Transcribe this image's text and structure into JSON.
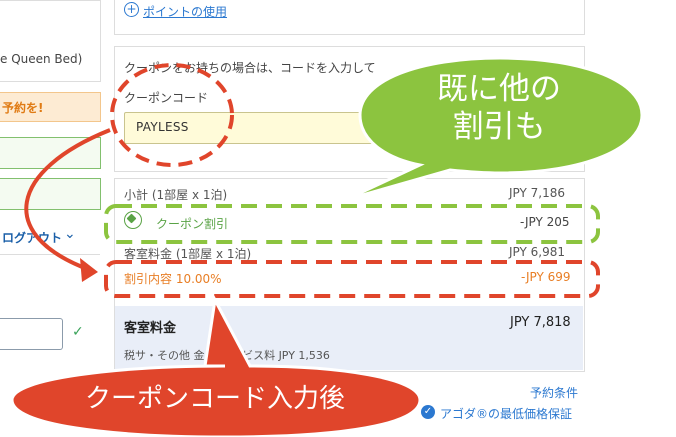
{
  "left_panel": {
    "room_type_fragment": "e Queen Bed)",
    "notice_fragment": "予約を!",
    "logout_fragment": "ログアウト"
  },
  "points": {
    "link_label": "ポイントの使用"
  },
  "coupon": {
    "hint": "クーポンをお持ちの場合は、コードを入力して",
    "label": "クーポンコード",
    "value": "PAYLESS"
  },
  "price": {
    "subtotal_label": "小計 (1部屋 x 1泊)",
    "subtotal_value": "JPY 7,186",
    "coupon_discount_label": "クーポン割引",
    "coupon_discount_value": "-JPY 205",
    "room_fee_label": "客室料金 (1部屋 x 1泊)",
    "room_fee_value": "JPY 6,981",
    "discount_label": "割引内容 10.00%",
    "discount_value": "-JPY 699",
    "total_label": "客室料金",
    "total_value": "JPY 7,818",
    "tax_line": "税サ・その他 金 & サービス料 JPY 1,536"
  },
  "footer": {
    "terms_link": "予約条件",
    "price_guarantee": "アゴダ®の最低価格保証"
  },
  "annotations": {
    "green_bubble": "既に他の割引も",
    "red_bubble": "クーポンコード入力後"
  },
  "colors": {
    "accent_blue": "#2b78d0",
    "coupon_green": "#5aa346",
    "discount_orange": "#e87e25",
    "annotation_red": "#e0452b",
    "annotation_green": "#8cc43f"
  }
}
